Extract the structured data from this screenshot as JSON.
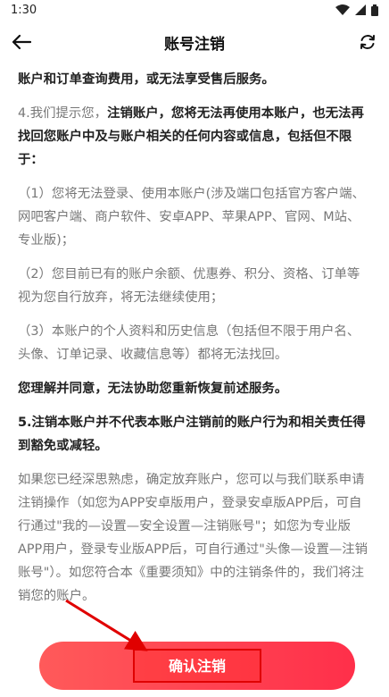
{
  "status": {
    "time": "1:30"
  },
  "nav": {
    "title": "账号注销"
  },
  "content": {
    "intro": "账户和订单查询费用，或无法享受售后服务。",
    "p4_prefix": "4.我们提示您，",
    "p4_bold": "注销账户，您将无法再使用本账户，也无法再找回您账户中及与账户相关的任何内容或信息，包括但不限于：",
    "item1": "（1）您将无法登录、使用本账户(涉及端口包括官方客户端、网吧客户端、商户软件、安卓APP、苹果APP、官网、M站、专业版)；",
    "item2": "（2）您目前已有的账户余额、优惠券、积分、资格、订单等视为您自行放弃，将无法继续使用；",
    "item3": "（3）本账户的个人资料和历史信息（包括但不限于用户名、头像、订单记录、收藏信息等）都将无法找回。",
    "agree": "您理解并同意，无法协助您重新恢复前述服务。",
    "p5": "5.注销本账户并不代表本账户注销前的账户行为和相关责任得到豁免或减轻。",
    "final": "如果您已经深思熟虑，确定放弃账户，您可以与我们联系申请注销操作（如您为APP安卓版用户，登录安卓版APP后，可自行通过\"我的—设置—安全设置—注销账号\"；如您为专业版APP用户，登录专业版APP后，可自行通过\"头像—设置—注销账号\"）。如您符合本《重要须知》中的注销条件的，我们将注销您的账户。"
  },
  "confirm": {
    "label": "确认注销"
  },
  "colors": {
    "accent": "#ff3a4f",
    "annotation": "#e00000"
  }
}
